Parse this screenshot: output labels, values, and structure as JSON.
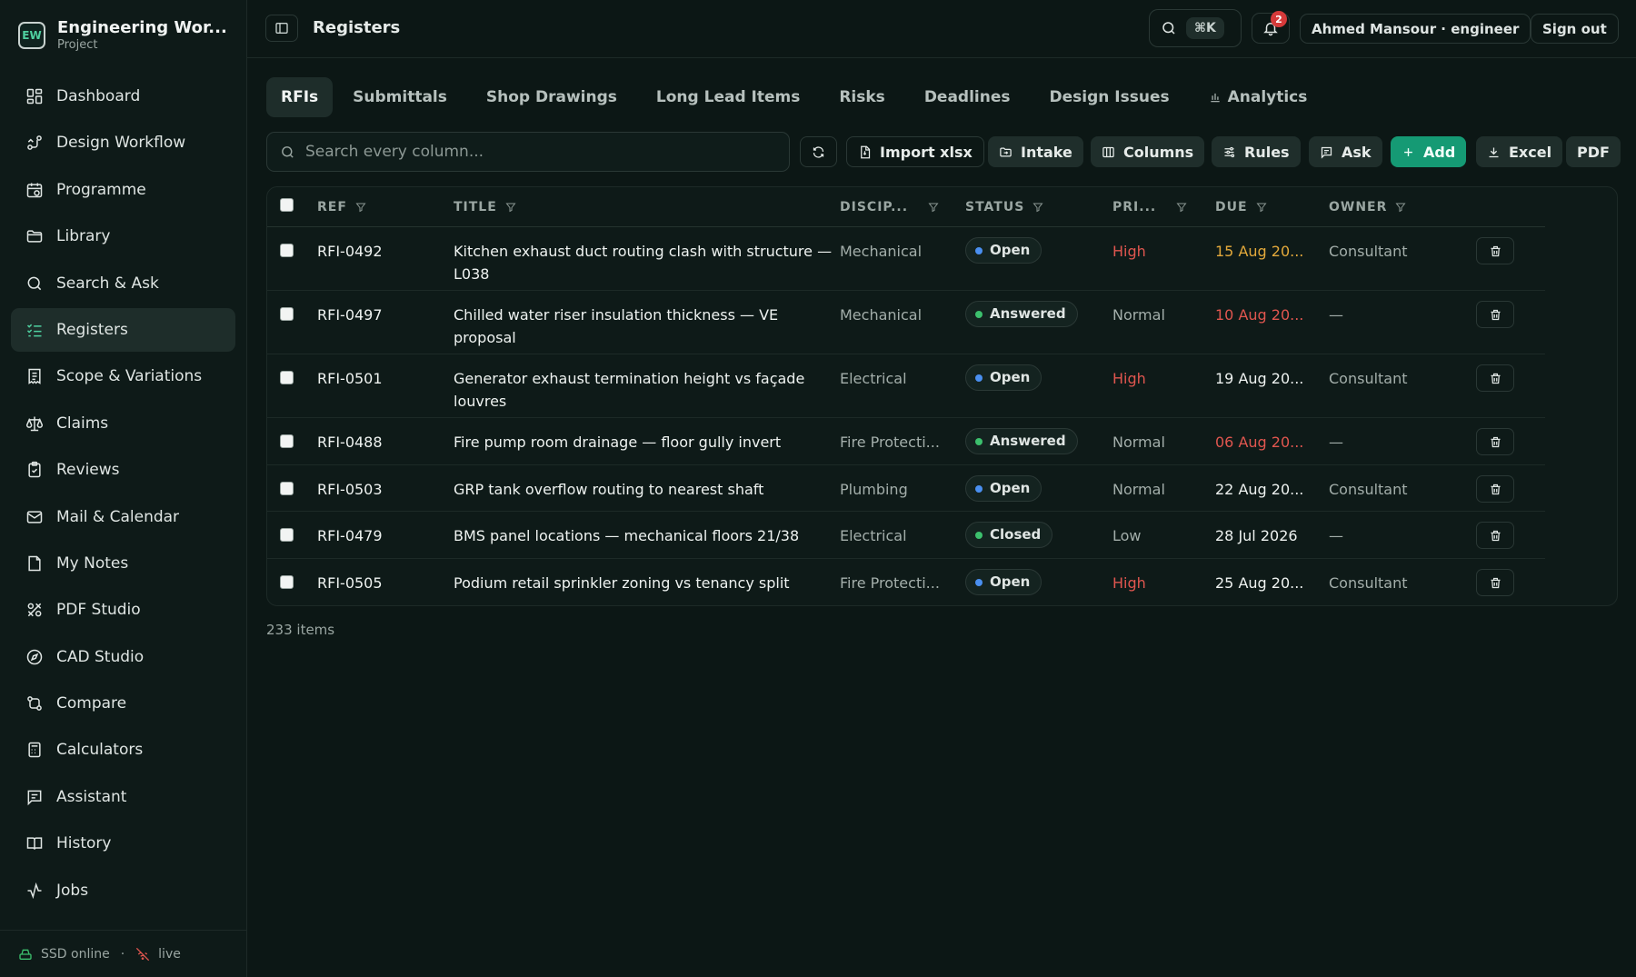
{
  "app": {
    "logo": "EW",
    "title": "Engineering Wor...",
    "subtitle": "Project"
  },
  "sidebar": {
    "items": [
      {
        "label": "Dashboard",
        "icon": "dashboard-icon"
      },
      {
        "label": "Design Workflow",
        "icon": "workflow-icon"
      },
      {
        "label": "Programme",
        "icon": "calendar-clock-icon"
      },
      {
        "label": "Library",
        "icon": "folder-icon"
      },
      {
        "label": "Search & Ask",
        "icon": "search-icon"
      },
      {
        "label": "Registers",
        "icon": "list-checks-icon",
        "active": true
      },
      {
        "label": "Scope & Variations",
        "icon": "receipt-icon"
      },
      {
        "label": "Claims",
        "icon": "scale-icon"
      },
      {
        "label": "Reviews",
        "icon": "clipboard-check-icon"
      },
      {
        "label": "Mail & Calendar",
        "icon": "mail-icon"
      },
      {
        "label": "My Notes",
        "icon": "sticky-note-icon"
      },
      {
        "label": "PDF Studio",
        "icon": "tools-icon"
      },
      {
        "label": "CAD Studio",
        "icon": "compass-icon"
      },
      {
        "label": "Compare",
        "icon": "git-compare-icon"
      },
      {
        "label": "Calculators",
        "icon": "calculator-icon"
      },
      {
        "label": "Assistant",
        "icon": "message-icon"
      },
      {
        "label": "History",
        "icon": "book-icon"
      },
      {
        "label": "Jobs",
        "icon": "activity-icon"
      }
    ],
    "footer": {
      "storage": "SSD online",
      "separator": "·",
      "live": "live"
    }
  },
  "header": {
    "page_title": "Registers",
    "shortcut": "⌘K",
    "notifications": "2",
    "user": "Ahmed Mansour · engineer",
    "signout": "Sign out"
  },
  "tabs": [
    {
      "label": "RFIs",
      "active": true
    },
    {
      "label": "Submittals"
    },
    {
      "label": "Shop Drawings"
    },
    {
      "label": "Long Lead Items"
    },
    {
      "label": "Risks"
    },
    {
      "label": "Deadlines"
    },
    {
      "label": "Design Issues"
    },
    {
      "label": "Analytics",
      "icon": "bar-chart-icon"
    }
  ],
  "toolbar": {
    "search_placeholder": "Search every column...",
    "import": "Import xlsx",
    "intake": "Intake",
    "columns": "Columns",
    "rules": "Rules",
    "ask": "Ask",
    "add": "Add",
    "excel": "Excel",
    "pdf": "PDF"
  },
  "table": {
    "columns": {
      "ref": "REF",
      "title": "TITLE",
      "discipline": "DISCIP...",
      "status": "STATUS",
      "priority": "PRI...",
      "due": "DUE",
      "owner": "OWNER"
    },
    "rows": [
      {
        "ref": "RFI-0492",
        "title": "Kitchen exhaust duct routing clash with structure — L038",
        "discipline": "Mechanical",
        "status": "Open",
        "priority": "High",
        "due": "15 Aug 20...",
        "owner": "Consultant"
      },
      {
        "ref": "RFI-0497",
        "title": "Chilled water riser insulation thickness — VE proposal",
        "discipline": "Mechanical",
        "status": "Answered",
        "priority": "Normal",
        "due": "10 Aug 20...",
        "owner": "—"
      },
      {
        "ref": "RFI-0501",
        "title": "Generator exhaust termination height vs façade louvres",
        "discipline": "Electrical",
        "status": "Open",
        "priority": "High",
        "due": "19 Aug 20...",
        "owner": "Consultant"
      },
      {
        "ref": "RFI-0488",
        "title": "Fire pump room drainage — floor gully invert",
        "discipline": "Fire Protecti...",
        "status": "Answered",
        "priority": "Normal",
        "due": "06 Aug 20...",
        "owner": "—"
      },
      {
        "ref": "RFI-0503",
        "title": "GRP tank overflow routing to nearest shaft",
        "discipline": "Plumbing",
        "status": "Open",
        "priority": "Normal",
        "due": "22 Aug 20...",
        "owner": "Consultant"
      },
      {
        "ref": "RFI-0479",
        "title": "BMS panel locations — mechanical floors 21/38",
        "discipline": "Electrical",
        "status": "Closed",
        "priority": "Low",
        "due": "28 Jul 2026",
        "owner": "—"
      },
      {
        "ref": "RFI-0505",
        "title": "Podium retail sprinkler zoning vs tenancy split",
        "discipline": "Fire Protecti...",
        "status": "Open",
        "priority": "High",
        "due": "25 Aug 20...",
        "owner": "Consultant"
      }
    ],
    "count": "233 items"
  },
  "colors": {
    "accent": "#4fd0a0",
    "primary": "#159a74",
    "high": "#e0564f",
    "due_warn": "#e3a93b",
    "due_overdue": "#e0564f",
    "open_dot": "#4a8ff0",
    "answered_dot": "#3cc06d",
    "closed_dot": "#3cc06d"
  }
}
